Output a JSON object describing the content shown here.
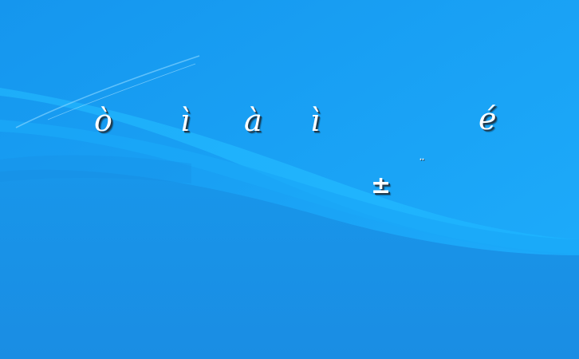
{
  "desktop": {
    "background": {
      "base_color": "#1796eb",
      "highlight_color": "#1fb6ff",
      "shadow_color": "#0f7fd6"
    },
    "glyphs": {
      "g1": "ò",
      "g2": "ì",
      "g3": "à",
      "g4": "ì",
      "g5": "é",
      "g6": "±",
      "g7": "¨"
    }
  }
}
